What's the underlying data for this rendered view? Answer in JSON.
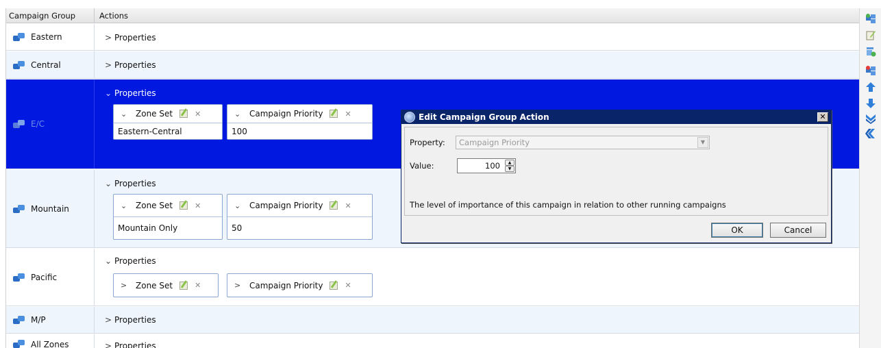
{
  "grid": {
    "columns": {
      "group": "Campaign Group",
      "actions": "Actions"
    },
    "properties_label": "Properties",
    "rows": [
      {
        "name": "Eastern",
        "expanded": false
      },
      {
        "name": "Central",
        "expanded": false
      },
      {
        "name": "E/C",
        "expanded": true,
        "selected": true,
        "actions": [
          {
            "title": "Zone Set",
            "value": "Eastern-Central"
          },
          {
            "title": "Campaign Priority",
            "value": "100"
          }
        ]
      },
      {
        "name": "Mountain",
        "expanded": true,
        "actions": [
          {
            "title": "Zone Set",
            "value": "Mountain Only"
          },
          {
            "title": "Campaign Priority",
            "value": "50"
          }
        ]
      },
      {
        "name": "Pacific",
        "expanded": true,
        "actions": [
          {
            "title": "Zone Set",
            "collapsed": true
          },
          {
            "title": "Campaign Priority",
            "collapsed": true
          }
        ]
      },
      {
        "name": "M/P",
        "expanded": false
      },
      {
        "name": "All Zones",
        "expanded": false
      }
    ]
  },
  "toolbar": {
    "icons": [
      "add-group-icon",
      "edit-icon",
      "add-action-icon",
      "remove-group-icon",
      "move-up-icon",
      "move-down-icon",
      "move-bottom-icon",
      "collapse-all-icon"
    ]
  },
  "dialog": {
    "title": "Edit Campaign Group Action",
    "close_glyph": "✕",
    "property_label": "Property:",
    "property_value": "Campaign Priority",
    "value_label": "Value:",
    "value": "100",
    "description": "The level of importance of this campaign in relation to other running campaigns",
    "ok_label": "OK",
    "cancel_label": "Cancel"
  },
  "colors": {
    "selection": "#0018e0",
    "alt_row": "#eef5fc",
    "dialog_title": "#0a246a"
  }
}
